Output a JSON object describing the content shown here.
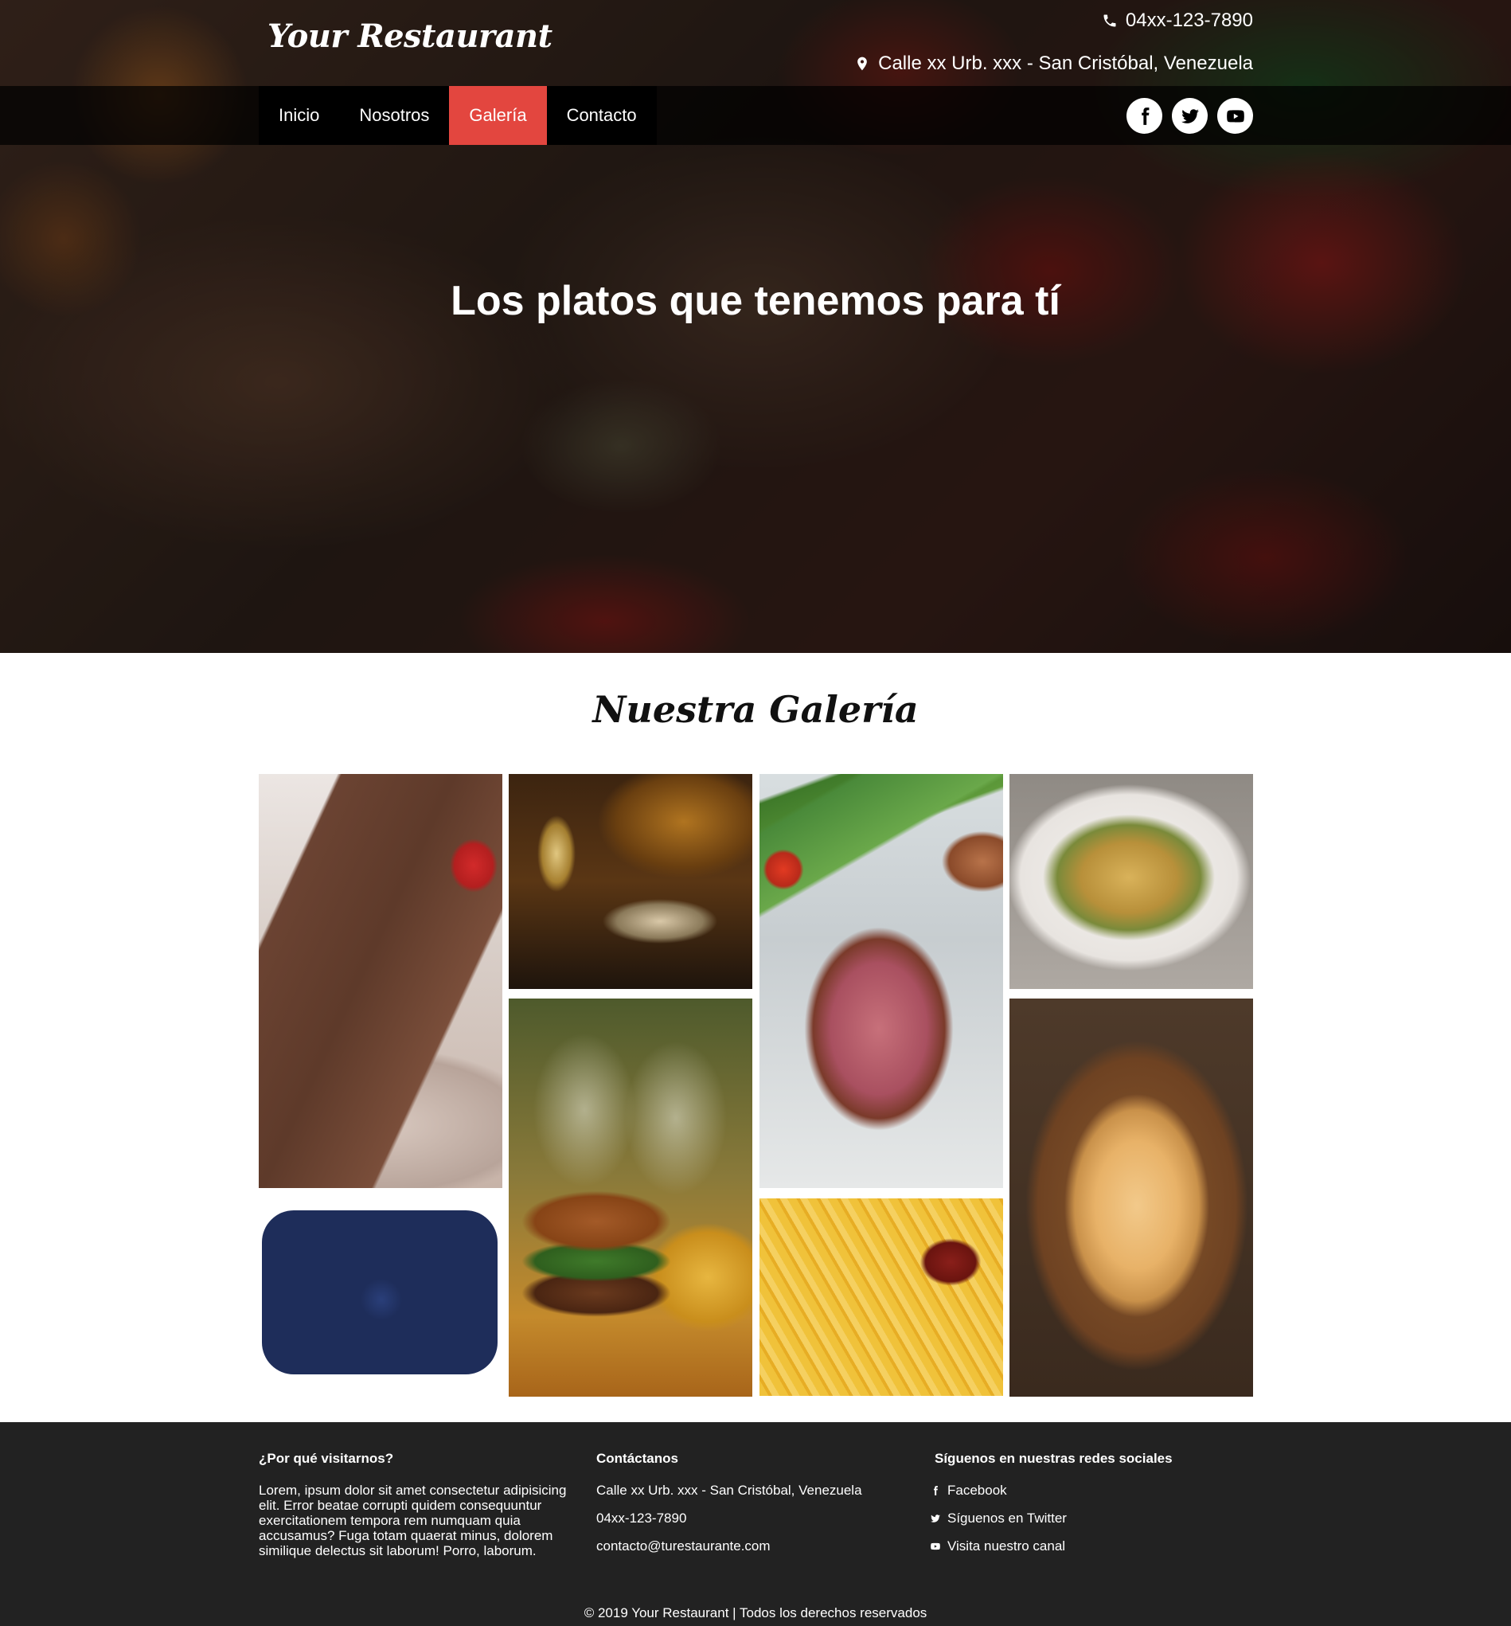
{
  "header": {
    "logo": "Your Restaurant",
    "phone": "04xx-123-7890",
    "address": "Calle xx Urb. xxx - San Cristóbal, Venezuela",
    "phone_icon": "phone-icon",
    "address_icon": "map-marker-icon"
  },
  "nav": {
    "items": [
      "Inicio",
      "Nosotros",
      "Galería",
      "Contacto"
    ],
    "active": "Galería",
    "active_color": "#e3463f"
  },
  "socials": [
    "facebook-icon",
    "twitter-icon",
    "youtube-icon"
  ],
  "hero": {
    "title": "Los platos que tenemos para tí"
  },
  "gallery": {
    "title": "Nuestra Galería",
    "images": [
      "chocolate-cake",
      "wine-restaurant",
      "grilled-steak-asparagus",
      "vegetable-casserole",
      "fruit-platter",
      "burger-fries",
      "french-fries",
      "pasta-bowl"
    ]
  },
  "footer": {
    "col1": {
      "heading": "¿Por qué visitarnos?",
      "text": "Lorem, ipsum dolor sit amet consectetur adipisicing elit. Error beatae corrupti quidem consequuntur exercitationem tempora rem numquam quia accusamus? Fuga totam quaerat minus, dolorem similique delectus sit laborum! Porro, laborum."
    },
    "col2": {
      "heading": "Contáctanos",
      "address": "Calle xx Urb. xxx - San Cristóbal, Venezuela",
      "phone": "04xx-123-7890",
      "email": "contacto@turestaurante.com"
    },
    "col3": {
      "heading": "Síguenos en nuestras redes sociales",
      "facebook": "Facebook",
      "twitter": "Síguenos en Twitter",
      "youtube": "Visita nuestro canal"
    },
    "copyright": "© 2019 Your Restaurant | Todos los derechos reservados",
    "background": "#222222"
  }
}
